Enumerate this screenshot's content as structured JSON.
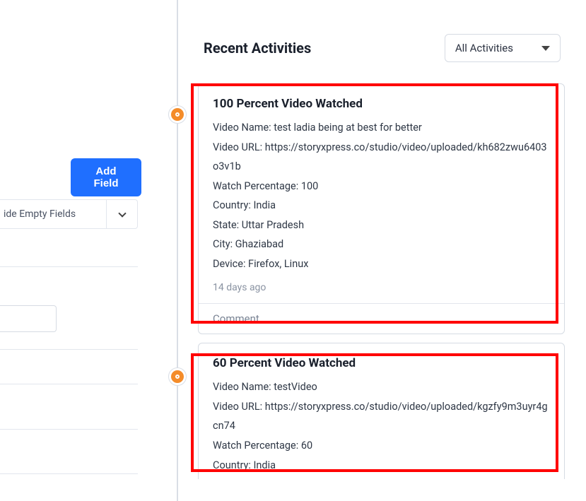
{
  "left": {
    "add_field_label": "Add Field",
    "hide_empty_label": "ide Empty Fields"
  },
  "right": {
    "title": "Recent Activities",
    "filter_selected": "All Activities"
  },
  "activities": [
    {
      "title": "100 Percent Video Watched",
      "lines": [
        "Video Name: test ladia being at best for better",
        "Video URL: https://storyxpress.co/studio/video/uploaded/kh682zwu6403o3v1b",
        "Watch Percentage: 100",
        "Country: India",
        "State: Uttar Pradesh",
        "City: Ghaziabad",
        "Device: Firefox, Linux"
      ],
      "time": "14 days ago",
      "comment_placeholder": "Comment"
    },
    {
      "title": "60 Percent Video Watched",
      "lines": [
        "Video Name: testVideo",
        "Video URL: https://storyxpress.co/studio/video/uploaded/kgzfy9m3uyr4gcn74",
        "Watch Percentage: 60",
        "Country: India"
      ],
      "time": "",
      "comment_placeholder": ""
    }
  ]
}
